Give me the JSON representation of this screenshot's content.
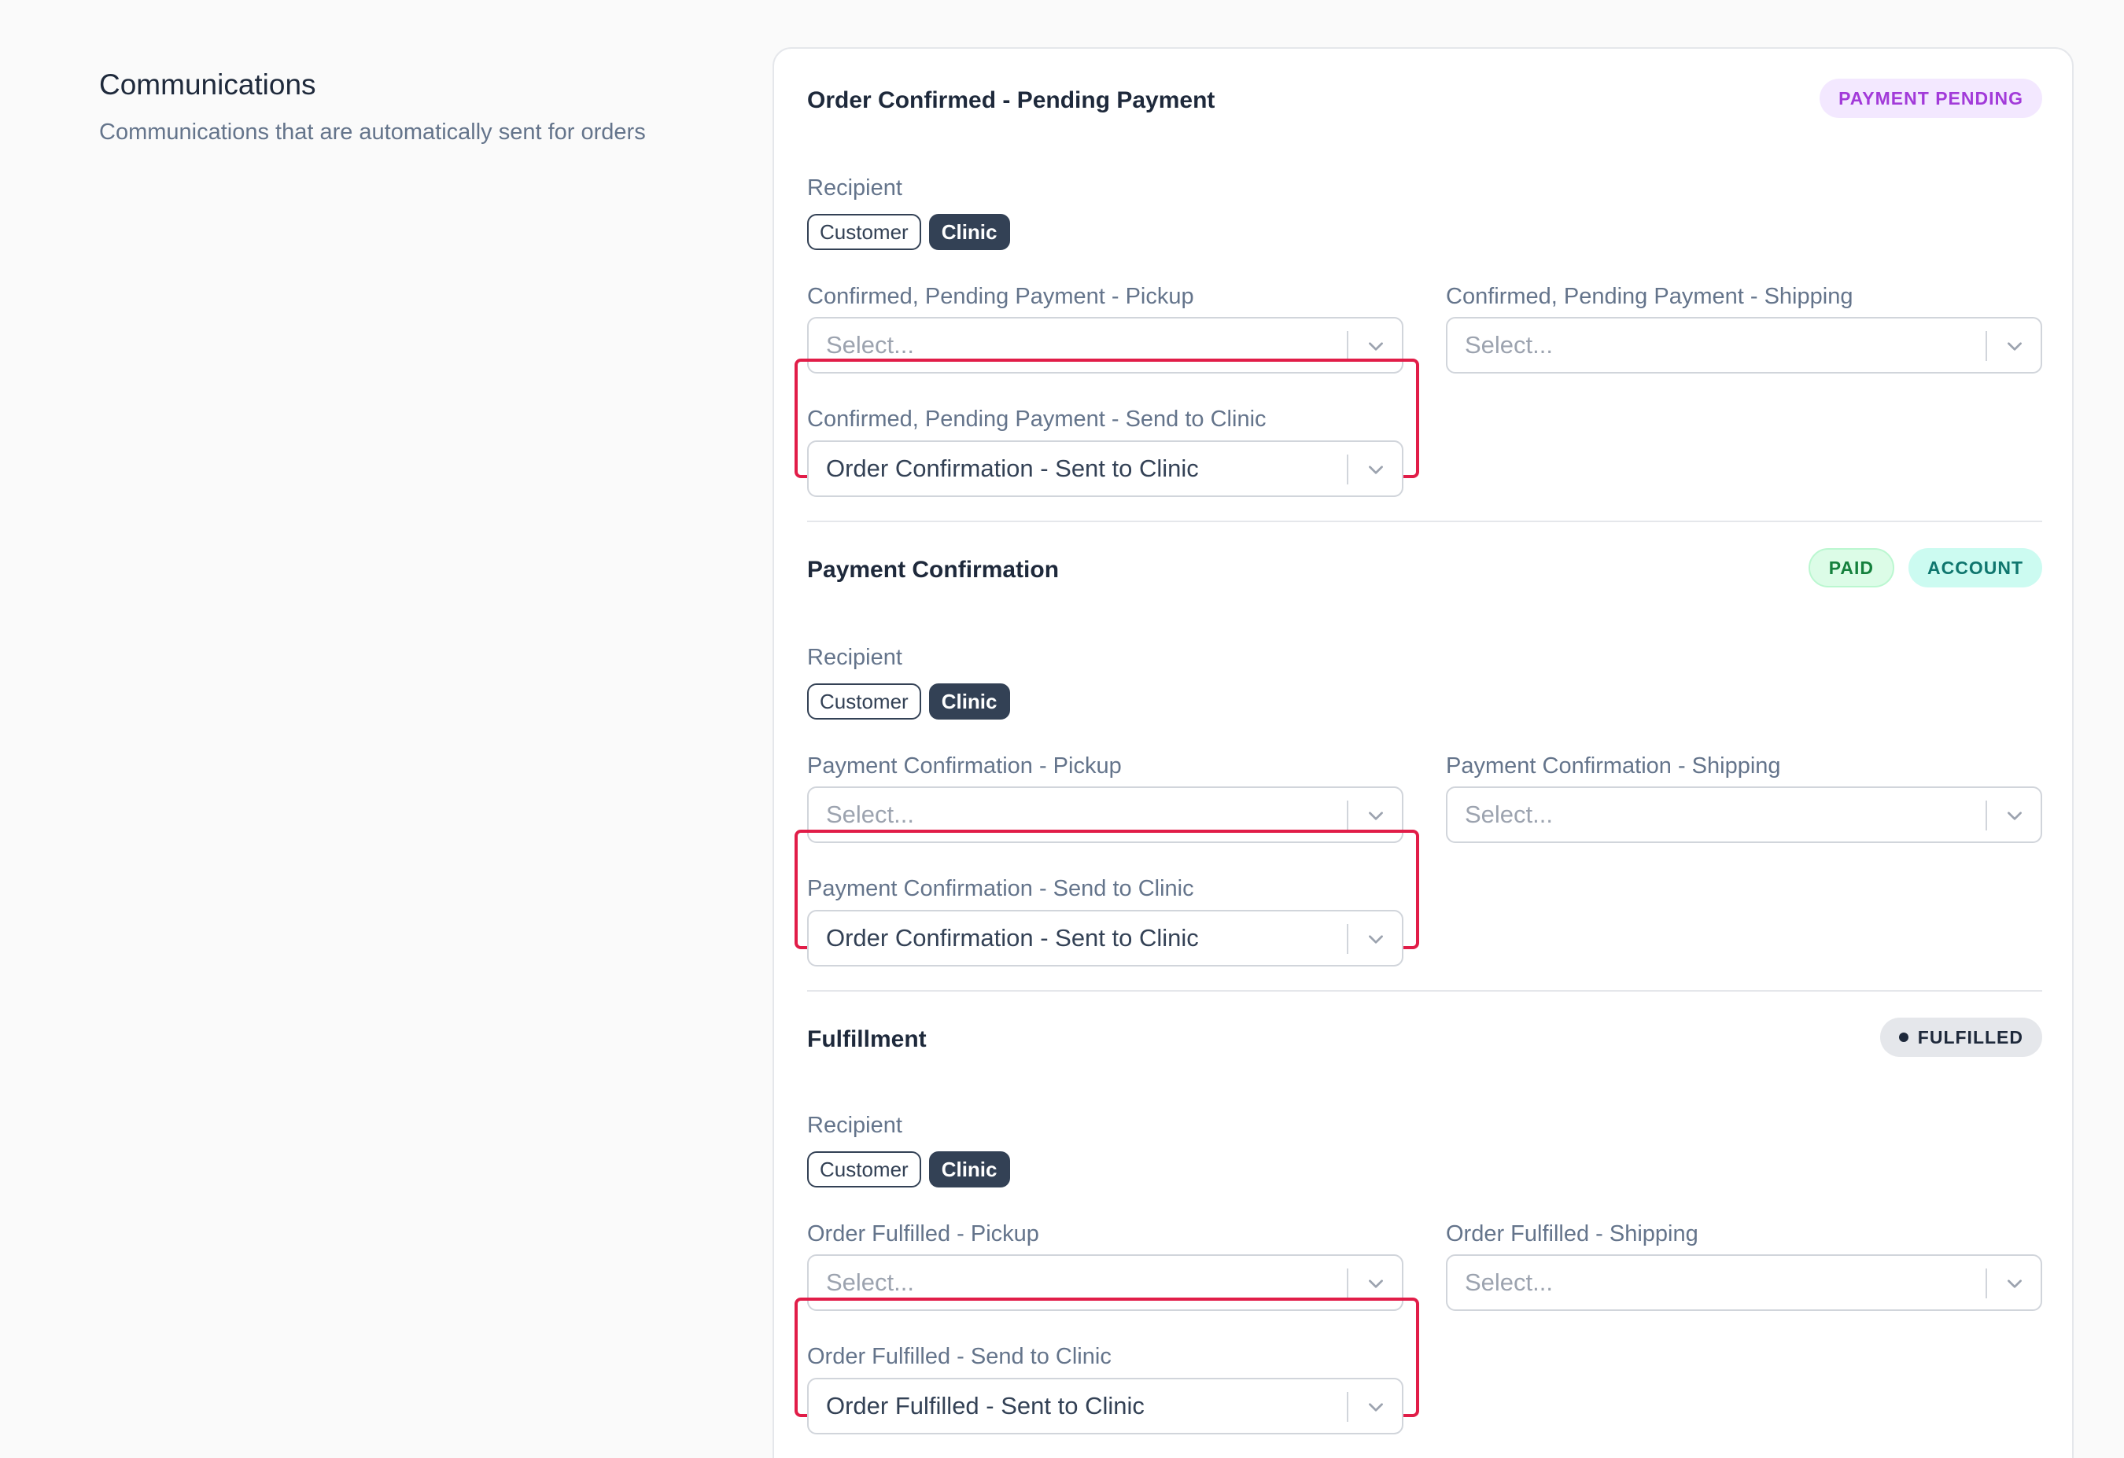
{
  "intro": {
    "title": "Communications",
    "description": "Communications that are automatically sent for orders"
  },
  "sections": [
    {
      "title": "Order Confirmed - Pending Payment",
      "badges": [
        "PAYMENT PENDING"
      ],
      "recipient_label": "Recipient",
      "chips": [
        "Customer",
        "Clinic"
      ],
      "pickup": {
        "label": "Confirmed, Pending Payment - Pickup",
        "placeholder": "Select..."
      },
      "shipping": {
        "label": "Confirmed, Pending Payment - Shipping",
        "placeholder": "Select..."
      },
      "clinic": {
        "label": "Confirmed, Pending Payment - Send to Clinic",
        "value": "Order Confirmation - Sent to Clinic"
      }
    },
    {
      "title": "Payment Confirmation",
      "badges": [
        "PAID",
        "ACCOUNT"
      ],
      "recipient_label": "Recipient",
      "chips": [
        "Customer",
        "Clinic"
      ],
      "pickup": {
        "label": "Payment Confirmation - Pickup",
        "placeholder": "Select..."
      },
      "shipping": {
        "label": "Payment Confirmation - Shipping",
        "placeholder": "Select..."
      },
      "clinic": {
        "label": "Payment Confirmation - Send to Clinic",
        "value": "Order Confirmation - Sent to Clinic"
      }
    },
    {
      "title": "Fulfillment",
      "badges": [
        "FULFILLED"
      ],
      "recipient_label": "Recipient",
      "chips": [
        "Customer",
        "Clinic"
      ],
      "pickup": {
        "label": "Order Fulfilled - Pickup",
        "placeholder": "Select..."
      },
      "shipping": {
        "label": "Order Fulfilled - Shipping",
        "placeholder": "Select..."
      },
      "clinic": {
        "label": "Order Fulfilled - Send to Clinic",
        "value": "Order Fulfilled - Sent to Clinic"
      }
    }
  ],
  "colors": {
    "highlight": "#e11d48",
    "chip_selected": "#334155",
    "badge_pending_text": "#a23ad9",
    "badge_paid_text": "#15803d",
    "badge_account_text": "#0f766e"
  },
  "icons": {
    "select_indicator": "chevron-down-icon",
    "status_dot": "dot-icon"
  }
}
